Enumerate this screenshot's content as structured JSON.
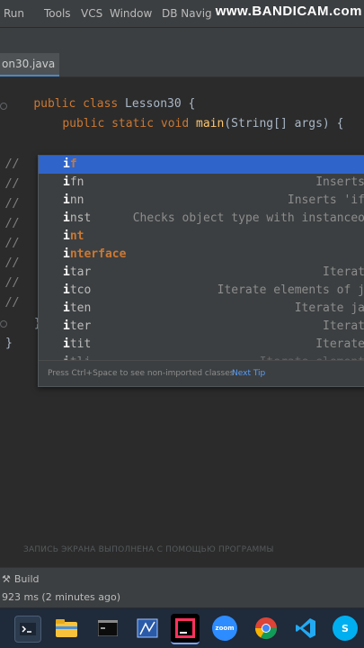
{
  "menubar": {
    "items": [
      "Run",
      "Tools",
      "VCS",
      "Window",
      "DB Navig"
    ],
    "watermark": "www.BANDICAM.com"
  },
  "tabs": [
    {
      "label": "on30.java"
    }
  ],
  "editor": {
    "line1": {
      "kw": "public class",
      "rest": " Lesson30 {"
    },
    "line2": {
      "kw": "public static void",
      "fn": "main",
      "rest": "(String[] args) {"
    },
    "typed": "i",
    "comment_marker": "//",
    "brace": "}"
  },
  "completion": {
    "items": [
      {
        "name": "if",
        "desc": "",
        "type": "keyword",
        "selected": true
      },
      {
        "name": "ifn",
        "desc": "Inserts",
        "type": "template"
      },
      {
        "name": "inn",
        "desc": "Inserts 'if",
        "type": "template"
      },
      {
        "name": "inst",
        "desc": "Checks object type with instanceo",
        "type": "template"
      },
      {
        "name": "int",
        "desc": "",
        "type": "keyword"
      },
      {
        "name": "interface",
        "desc": "",
        "type": "keyword"
      },
      {
        "name": "itar",
        "desc": "Iterat",
        "type": "template"
      },
      {
        "name": "itco",
        "desc": "Iterate elements of j",
        "type": "template"
      },
      {
        "name": "iten",
        "desc": "Iterate ja",
        "type": "template"
      },
      {
        "name": "iter",
        "desc": "Iterat",
        "type": "template"
      },
      {
        "name": "itit",
        "desc": "Iterate",
        "type": "template"
      },
      {
        "name": "itli",
        "desc": "Iterate element",
        "type": "template"
      }
    ],
    "footer_hint": "Press Ctrl+Space to see non-imported classes",
    "next_tip": "Next Tip"
  },
  "ghost_overlay": "ЗАПИСЬ ЭКРАНА ВЫПОЛНЕНА С ПОМОЩЬЮ ПРОГРАММЫ",
  "bottom": {
    "build_label": "Build",
    "status": "923 ms (2 minutes ago)"
  },
  "taskbar": {
    "icons": [
      "terminal-icon",
      "file-explorer-icon",
      "command-prompt-icon",
      "snipping-icon",
      "intellij-icon",
      "zoom-icon",
      "chrome-icon",
      "vscode-icon",
      "skype-icon"
    ],
    "zoom_label": "zoom",
    "intellij_label": "IJ",
    "skype_label": "S"
  },
  "colors": {
    "keyword": "#cc7832",
    "method": "#ffc66d",
    "selection": "#2f65ca",
    "link": "#589df6"
  }
}
